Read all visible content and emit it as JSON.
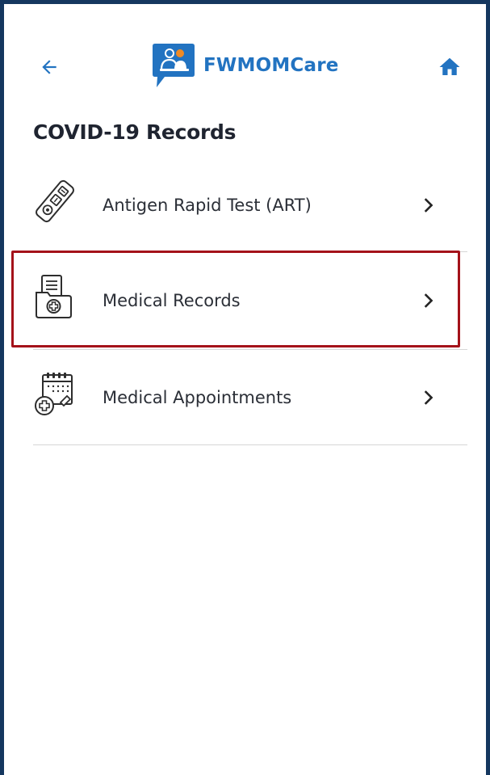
{
  "app": {
    "name": "FWMOMCare",
    "brand_color": "#2273c1",
    "frame_color": "#15375f",
    "highlight_color": "#a4121a"
  },
  "header": {
    "back_icon": "arrow-left-icon",
    "home_icon": "home-icon",
    "logo_icon": "fwmomcare-logo-icon"
  },
  "page": {
    "title": "COVID-19 Records"
  },
  "menu": {
    "items": [
      {
        "label": "Antigen Rapid Test (ART)",
        "icon": "test-kit-icon",
        "highlighted": false
      },
      {
        "label": "Medical Records",
        "icon": "medical-folder-icon",
        "highlighted": true
      },
      {
        "label": "Medical Appointments",
        "icon": "calendar-medical-icon",
        "highlighted": false
      }
    ]
  }
}
